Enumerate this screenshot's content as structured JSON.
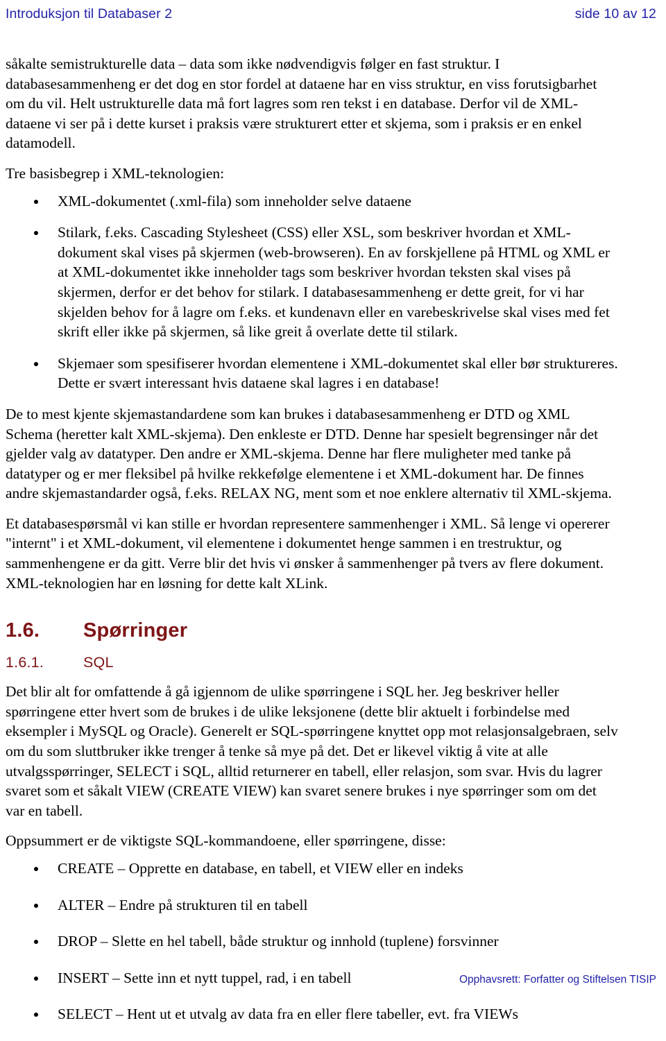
{
  "header": {
    "title": "Introduksjon til Databaser 2",
    "page_label": "side 10 av 12",
    "color": "#2323a8"
  },
  "footer": {
    "copyright": "Opphavsrett:  Forfatter og Stiftelsen TISIP",
    "color": "#2323a8"
  },
  "theme": {
    "heading_color": "#7e1416",
    "body_color": "#000000",
    "background": "#ffffff"
  },
  "body": {
    "p_intro": "såkalte semistrukturelle data – data som ikke nødvendigvis følger en fast struktur. I databasesammenheng er det dog en stor fordel at dataene har en viss struktur, en viss forutsigbarhet om du vil. Helt ustrukturelle data må fort lagres som ren tekst i en database. Derfor vil de XML-dataene vi ser på i dette kurset i praksis være strukturert etter et skjema, som i praksis er en enkel datamodell.",
    "p_three_concepts_lead": "Tre basisbegrep i XML-teknologien:",
    "concepts": [
      "XML-dokumentet (.xml-fila) som inneholder selve dataene",
      "Stilark, f.eks. Cascading Stylesheet (CSS) eller XSL, som beskriver hvordan et XML-dokument skal vises på skjermen (web-browseren). En av forskjellene på HTML og XML er at XML-dokumentet ikke inneholder tags som beskriver hvordan teksten skal vises på skjermen, derfor er det behov for stilark. I databasesammenheng er dette greit, for vi har skjelden behov for å lagre om f.eks. et kundenavn eller en varebeskrivelse skal vises med fet skrift eller ikke på skjermen, så like greit å overlate dette til stilark.",
      "Skjemaer som spesifiserer hvordan elementene i XML-dokumentet skal eller bør struktureres. Dette er svært interessant hvis dataene skal lagres i en database!"
    ],
    "p_schema_standards": "De to mest kjente skjemastandardene som kan brukes i databasesammenheng er DTD og XML Schema (heretter kalt XML-skjema). Den enkleste er DTD. Denne har spesielt begrensinger når det gjelder valg av datatyper. Den andre er XML-skjema. Denne har flere muligheter med tanke på datatyper og er mer fleksibel på hvilke rekkefølge elementene i et XML-dokument har. De finnes andre skjemastandarder også, f.eks. RELAX NG, ment som et noe enklere alternativ til XML-skjema.",
    "p_relationships": "Et databasespørsmål vi kan stille er hvordan representere sammenhenger i XML. Så lenge vi opererer \"internt\" i et XML-dokument, vil elementene i dokumentet henge sammen i en trestruktur, og sammenhengene er da gitt. Verre blir det hvis vi ønsker å sammenhenger på tvers av flere dokument. XML-teknologien har en løsning for dette kalt XLink."
  },
  "section_queries": {
    "number": "1.6.",
    "title": "Spørringer"
  },
  "section_sql": {
    "number": "1.6.1.",
    "title": "SQL",
    "p_sql_intro": "Det blir alt for omfattende å gå igjennom de ulike spørringene i SQL her. Jeg beskriver heller spørringene etter hvert som de brukes i de ulike leksjonene (dette blir aktuelt i forbindelse med eksempler i MySQL og Oracle). Generelt er SQL-spørringene knyttet opp mot relasjonsalgebraen, selv om du som sluttbruker ikke trenger å tenke så mye på det. Det er likevel viktig å vite at alle utvalgsspørringer, SELECT i SQL, alltid returnerer en tabell, eller relasjon, som svar. Hvis du lagrer svaret som et såkalt VIEW (CREATE VIEW) kan svaret senere brukes i nye spørringer som om det var en tabell.",
    "p_summary_lead": "Oppsummert er de viktigste SQL-kommandoene, eller spørringene, disse:",
    "commands": [
      "CREATE – Opprette en database, en tabell, et VIEW eller en indeks",
      "ALTER – Endre på strukturen til en tabell",
      "DROP – Slette en hel tabell, både struktur og innhold (tuplene) forsvinner",
      "INSERT – Sette inn et nytt tuppel, rad, i en tabell",
      "SELECT – Hent ut et utvalg av data fra en eller flere tabeller, evt. fra VIEWs"
    ]
  }
}
